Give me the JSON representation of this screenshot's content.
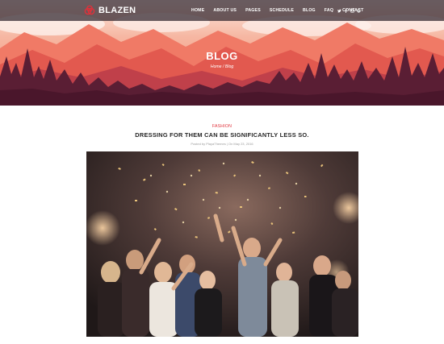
{
  "brand": {
    "name": "BLAZEN",
    "icon": "blazen-logo-icon"
  },
  "nav": {
    "items": [
      {
        "label": "HOME"
      },
      {
        "label": "ABOUT US"
      },
      {
        "label": "PAGES"
      },
      {
        "label": "SCHEDULE"
      },
      {
        "label": "BLOG"
      },
      {
        "label": "FAQ"
      },
      {
        "label": "CONTACT"
      }
    ]
  },
  "social": [
    "twitter-icon",
    "facebook-icon",
    "instagram-icon",
    "dribbble-icon"
  ],
  "hero": {
    "title": "BLOG",
    "breadcrumb": {
      "home": "Home",
      "separator": " / ",
      "current": "Blog"
    }
  },
  "post": {
    "category": "FASHION",
    "title": "DRESSING FOR THEM CAN BE SIGNIFICANTLY LESS SO.",
    "meta": "Posted by PlayaThemes  |  On May 23, 2016"
  },
  "colors": {
    "accent": "#e0313a",
    "nav_bg": "#30262e",
    "hero_sky": "#f29a80",
    "hero_forest": "#5a1e34"
  }
}
